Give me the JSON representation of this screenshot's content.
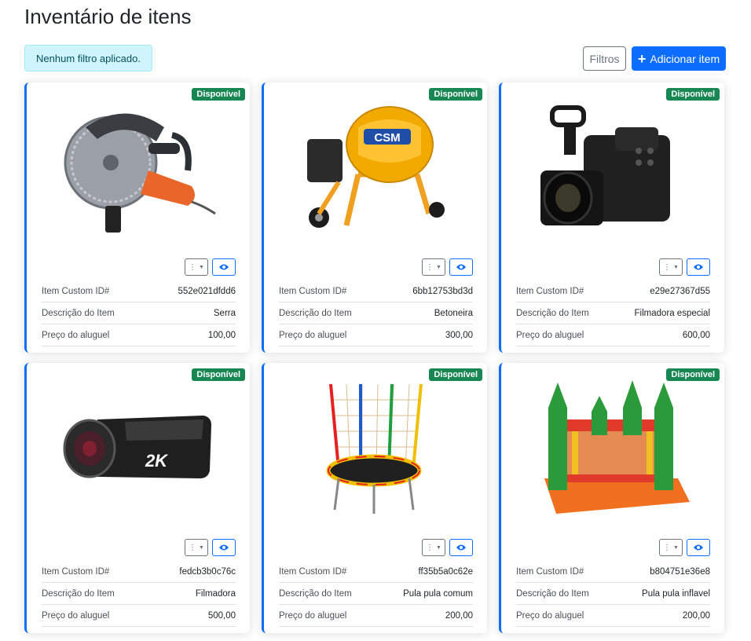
{
  "page": {
    "title": "Inventário de itens",
    "filter_status": "Nenhum filtro aplicado.",
    "filters_button": "Filtros",
    "add_button": "Adicionar item"
  },
  "labels": {
    "custom_id": "Item Custom ID#",
    "description": "Descrição do Item",
    "price": "Preço do aluguel"
  },
  "colors": {
    "primary": "#0d6efd",
    "success": "#198754",
    "info_bg": "#cff4fc"
  },
  "items": [
    {
      "status": "Disponível",
      "custom_id": "552e021dfdd6",
      "description": "Serra",
      "price": "100,00",
      "image_icon": "saw-icon"
    },
    {
      "status": "Disponível",
      "custom_id": "6bb12753bd3d",
      "description": "Betoneira",
      "price": "300,00",
      "image_icon": "concrete-mixer-icon",
      "image_text": "CSM"
    },
    {
      "status": "Disponível",
      "custom_id": "e29e27367d55",
      "description": "Filmadora especial",
      "price": "600,00",
      "image_icon": "pro-camcorder-icon"
    },
    {
      "status": "Disponível",
      "custom_id": "fedcb3b0c76c",
      "description": "Filmadora",
      "price": "500,00",
      "image_icon": "camcorder-icon",
      "image_text": "2K"
    },
    {
      "status": "Disponível",
      "custom_id": "ff35b5a0c62e",
      "description": "Pula pula comum",
      "price": "200,00",
      "image_icon": "trampoline-icon"
    },
    {
      "status": "Disponível",
      "custom_id": "b804751e36e8",
      "description": "Pula pula inflavel",
      "price": "200,00",
      "image_icon": "bounce-house-icon"
    }
  ]
}
